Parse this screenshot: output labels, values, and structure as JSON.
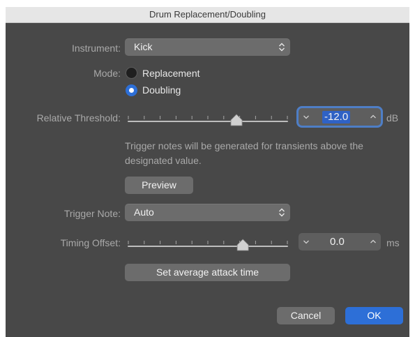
{
  "window": {
    "title": "Drum Replacement/Doubling"
  },
  "instrument": {
    "label": "Instrument:",
    "value": "Kick"
  },
  "mode": {
    "label": "Mode:",
    "options": [
      {
        "label": "Replacement",
        "selected": false
      },
      {
        "label": "Doubling",
        "selected": true
      }
    ]
  },
  "threshold": {
    "label": "Relative Threshold:",
    "value": "-12.0",
    "unit": "dB",
    "slider_fraction": 0.68
  },
  "help_text": "Trigger notes will be generated for transients above the designated value.",
  "preview_button": "Preview",
  "trigger_note": {
    "label": "Trigger Note:",
    "value": "Auto"
  },
  "timing_offset": {
    "label": "Timing Offset:",
    "value": "0.0",
    "unit": "ms",
    "slider_fraction": 0.72
  },
  "set_attack_button": "Set average attack time",
  "cancel_button": "Cancel",
  "ok_button": "OK",
  "colors": {
    "dialog_bg": "#484848",
    "accent": "#2d6fd7",
    "control_bg": "#6c6c6c"
  }
}
